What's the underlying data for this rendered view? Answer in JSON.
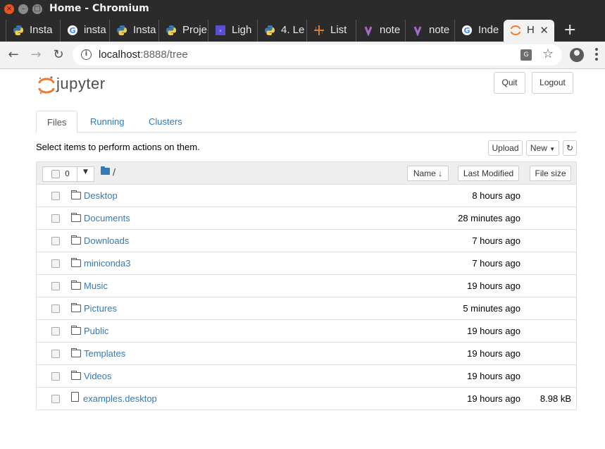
{
  "window": {
    "title": "Home - Chromium"
  },
  "tabs": [
    {
      "label": "Insta",
      "icon": "python-icon"
    },
    {
      "label": "insta",
      "icon": "google-icon"
    },
    {
      "label": "Insta",
      "icon": "python-icon"
    },
    {
      "label": "Proje",
      "icon": "python-icon"
    },
    {
      "label": "Ligh",
      "icon": "lightning-icon"
    },
    {
      "label": "4. Le",
      "icon": "python-icon"
    },
    {
      "label": "List",
      "icon": "tableau-icon"
    },
    {
      "label": "note",
      "icon": "onenote-icon"
    },
    {
      "label": "note",
      "icon": "onenote-icon"
    },
    {
      "label": "Inde",
      "icon": "google-icon"
    },
    {
      "label": "H",
      "icon": "jupyter-icon",
      "active": true
    }
  ],
  "address": {
    "host": "localhost",
    "rest": ":8888/tree"
  },
  "header": {
    "logo_text": "jupyter",
    "quit": "Quit",
    "logout": "Logout"
  },
  "nav": {
    "files": "Files",
    "running": "Running",
    "clusters": "Clusters"
  },
  "toolbar": {
    "select_info": "Select items to perform actions on them.",
    "upload": "Upload",
    "new": "New"
  },
  "list_header": {
    "selected_count": "0",
    "path": "/",
    "sort_name": "Name",
    "sort_modified": "Last Modified",
    "sort_size": "File size"
  },
  "items": [
    {
      "name": "Desktop",
      "type": "folder",
      "modified": "8 hours ago",
      "size": ""
    },
    {
      "name": "Documents",
      "type": "folder",
      "modified": "28 minutes ago",
      "size": ""
    },
    {
      "name": "Downloads",
      "type": "folder",
      "modified": "7 hours ago",
      "size": ""
    },
    {
      "name": "miniconda3",
      "type": "folder",
      "modified": "7 hours ago",
      "size": ""
    },
    {
      "name": "Music",
      "type": "folder",
      "modified": "19 hours ago",
      "size": ""
    },
    {
      "name": "Pictures",
      "type": "folder",
      "modified": "5 minutes ago",
      "size": ""
    },
    {
      "name": "Public",
      "type": "folder",
      "modified": "19 hours ago",
      "size": ""
    },
    {
      "name": "Templates",
      "type": "folder",
      "modified": "19 hours ago",
      "size": ""
    },
    {
      "name": "Videos",
      "type": "folder",
      "modified": "19 hours ago",
      "size": ""
    },
    {
      "name": "examples.desktop",
      "type": "file",
      "modified": "19 hours ago",
      "size": "8.98 kB"
    }
  ],
  "colors": {
    "accent": "#337ab7",
    "jupyter_orange": "#f37726"
  }
}
